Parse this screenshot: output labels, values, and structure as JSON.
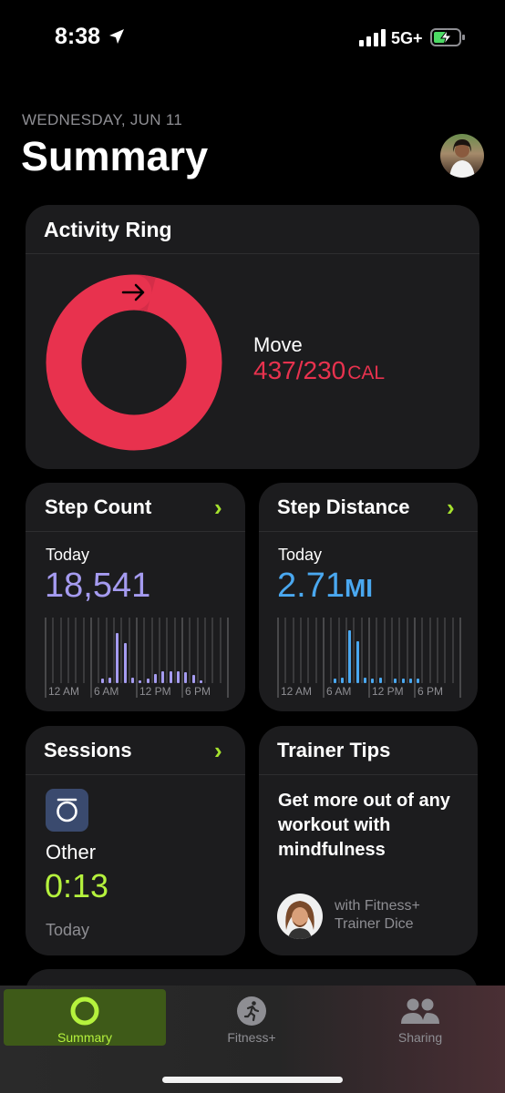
{
  "status_bar": {
    "time": "8:38",
    "network": "5G+"
  },
  "header": {
    "date": "WEDNESDAY, JUN 11",
    "title": "Summary"
  },
  "activity_ring": {
    "title": "Activity Ring",
    "move_label": "Move",
    "move_value": "437/230",
    "move_unit": "CAL",
    "ring_color": "#e8324e"
  },
  "step_count": {
    "title": "Step Count",
    "period": "Today",
    "value": "18,541",
    "value_color": "#a59bf0",
    "axis_labels": [
      "12 AM",
      "6 AM",
      "12 PM",
      "6 PM"
    ],
    "hourly_bars": [
      0,
      0,
      0,
      0,
      0,
      0,
      0,
      0.08,
      0.1,
      0.95,
      0.75,
      0.1,
      0.05,
      0.08,
      0.18,
      0.22,
      0.22,
      0.22,
      0.2,
      0.16,
      0.06,
      0,
      0,
      0
    ]
  },
  "step_distance": {
    "title": "Step Distance",
    "period": "Today",
    "value": "2.71",
    "unit": "MI",
    "value_color": "#4aa8f0",
    "axis_labels": [
      "12 AM",
      "6 AM",
      "12 PM",
      "6 PM"
    ],
    "hourly_bars": [
      0,
      0,
      0,
      0,
      0,
      0,
      0,
      0.08,
      0.1,
      1.0,
      0.8,
      0.1,
      0.08,
      0.1,
      0,
      0.08,
      0.08,
      0.08,
      0.08,
      0,
      0,
      0,
      0,
      0
    ]
  },
  "sessions": {
    "title": "Sessions",
    "workout_name": "Other",
    "duration": "0:13",
    "period": "Today",
    "duration_color": "#b5f23d"
  },
  "trainer_tips": {
    "title": "Trainer Tips",
    "tip": "Get more out of any workout with mindfulness",
    "with_line1": "with Fitness+",
    "with_line2": "Trainer Dice"
  },
  "tab_bar": {
    "tabs": [
      {
        "label": "Summary",
        "icon": "activity-ring-icon",
        "active": true
      },
      {
        "label": "Fitness+",
        "icon": "runner-icon",
        "active": false
      },
      {
        "label": "Sharing",
        "icon": "people-icon",
        "active": false
      }
    ],
    "active_color": "#b5f23d"
  }
}
